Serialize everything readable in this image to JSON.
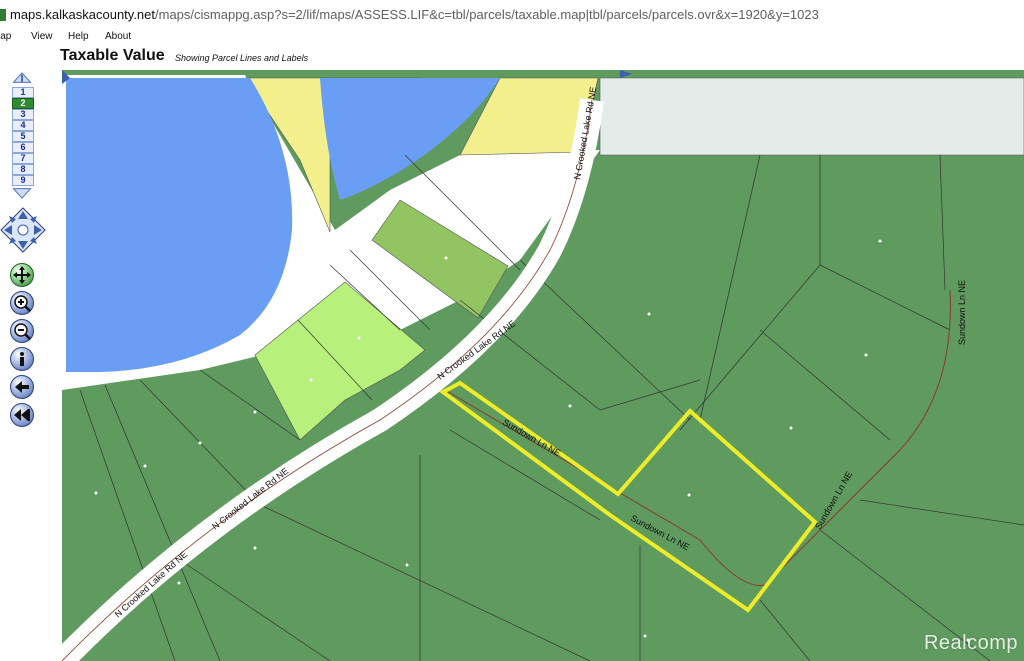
{
  "browser": {
    "url_host": "maps.kalkaskacounty.net",
    "url_path": "/maps/cismappg.asp?s=2/lif/maps/ASSESS.LIF&c=tbl/parcels/taxable.map|tbl/parcels/parcels.ovr&x=1920&y=1023"
  },
  "menu": {
    "items": [
      "lap",
      "View",
      "Help",
      "About"
    ]
  },
  "header": {
    "title": "Taxable Value",
    "subtitle": "Showing Parcel Lines and Labels"
  },
  "toolbar": {
    "zoom_levels": [
      "1",
      "2",
      "3",
      "4",
      "5",
      "6",
      "7",
      "8",
      "9"
    ],
    "active_zoom": "2",
    "tools": [
      "pan-tool",
      "zoom-in-tool",
      "zoom-out-tool",
      "info-tool",
      "back-tool",
      "rewind-tool"
    ]
  },
  "map": {
    "road_labels": [
      "N Crooked Lake Rd NE",
      "N Crooked Lake Rd NE",
      "N Crooked Lake Rd NE",
      "N Crooked Lake Rd NE",
      "Sundown Ln NE",
      "Sundown Ln NE",
      "Sundown Ln NE",
      "Sundown Ln NE"
    ],
    "colors": {
      "water": "#6a9ef5",
      "parcel": "#5f9a5e",
      "parcel_light": "#b7f07a",
      "parcel_mid": "#93c462",
      "parcel_yellow": "#f2ef8c",
      "road": "#ffffff",
      "highlight": "#ecec2a",
      "outside": "#e4ecea"
    }
  },
  "watermark": "Realcomp"
}
